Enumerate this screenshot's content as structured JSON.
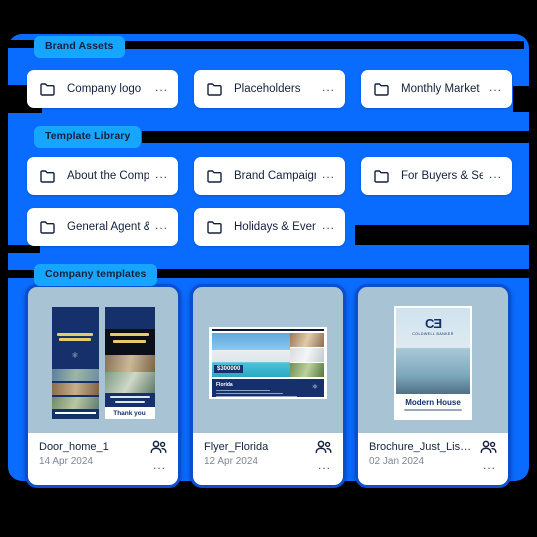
{
  "theme": {
    "page_background": "#000000",
    "panel_blue": "#0A6BFF",
    "pill_blue": "#16A6FF",
    "pill_text": "#112244",
    "card_border_blue": "#0B4FD0",
    "thumb_background": "#A7C3D4",
    "chip_background": "#FFFFFF",
    "chip_text": "#14213D",
    "brand_navy": "#15306B"
  },
  "sections": [
    {
      "id": "brand-assets",
      "title": "Brand Assets",
      "folders": [
        {
          "label": "Company logo",
          "icon": "folder-icon",
          "menu": "..."
        },
        {
          "label": "Placeholders",
          "icon": "folder-icon",
          "menu": "..."
        },
        {
          "label": "Monthly Market S...",
          "icon": "folder-icon",
          "menu": "..."
        }
      ]
    },
    {
      "id": "template-library",
      "title": "Template Library",
      "folders": [
        {
          "label": "About the Company",
          "icon": "folder-icon",
          "menu": "..."
        },
        {
          "label": "Brand Campaigns",
          "icon": "folder-icon",
          "menu": "..."
        },
        {
          "label": "For Buyers & Sellers",
          "icon": "folder-icon",
          "menu": "..."
        },
        {
          "label": "General Agent & T...",
          "icon": "folder-icon",
          "menu": "..."
        },
        {
          "label": "Holidays & Events",
          "icon": "folder-icon",
          "menu": "..."
        }
      ]
    },
    {
      "id": "company-templates",
      "title": "Company templates",
      "templates": [
        {
          "name": "Door_home_1",
          "date": "14 Apr 2024",
          "share_icon": "people-icon",
          "menu": "...",
          "art": "door-hanger",
          "art_text": {
            "headline": "The Real Estate Broker That Works For You !",
            "panel2_headline": "How much is your home worth?",
            "panel2_cta": "Call us today for a FREE market analysis of your home!",
            "panel2_footer": "Thank you"
          }
        },
        {
          "name": "Flyer_Florida",
          "date": "12 Apr 2024",
          "share_icon": "people-icon",
          "menu": "...",
          "art": "flyer",
          "art_text": {
            "price": "$300000",
            "location": "Florida",
            "logo": "CB"
          }
        },
        {
          "name": "Brochure_Just_Listed",
          "date": "02 Jan 2024",
          "share_icon": "people-icon",
          "menu": "...",
          "art": "brochure",
          "art_text": {
            "logo": "CB",
            "brand": "COLDWELL BANKER",
            "title": "Modern House",
            "address": "1 10 Palm Tree Avenue Sunnyvale, CA 94087"
          }
        }
      ]
    }
  ]
}
